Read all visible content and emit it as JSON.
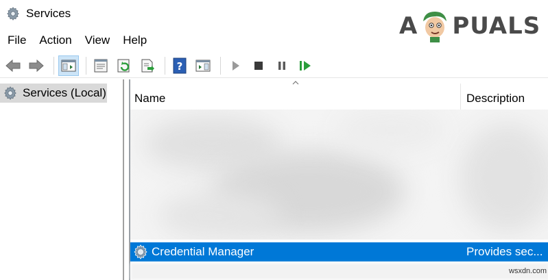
{
  "window": {
    "title": "Services",
    "icon": "gear-icon"
  },
  "watermark": {
    "text_left": "A",
    "text_right": "PUALS"
  },
  "menu": {
    "items": [
      "File",
      "Action",
      "View",
      "Help"
    ]
  },
  "toolbar": {
    "buttons": [
      "back-arrow-icon",
      "forward-arrow-icon",
      "show-hide-console-tree-icon",
      "properties-icon",
      "refresh-icon",
      "export-list-icon",
      "help-icon",
      "action-pane-icon",
      "start-service-icon",
      "stop-service-icon",
      "pause-service-icon",
      "restart-service-icon"
    ]
  },
  "tree": {
    "root_label": "Services (Local)"
  },
  "table": {
    "columns": [
      "Name",
      "Description"
    ],
    "selected_row": {
      "name": "Credential Manager",
      "description": "Provides sec..."
    }
  },
  "footer": {
    "credit": "wsxdn.com"
  },
  "colors": {
    "selection": "#0078d7",
    "tree_selected": "#d9d9d9",
    "accent_green": "#2a9d3a"
  }
}
